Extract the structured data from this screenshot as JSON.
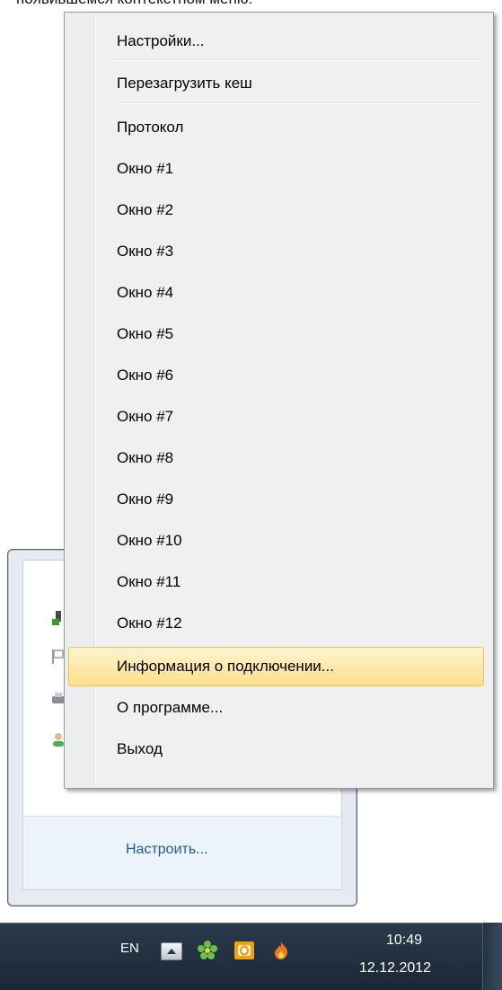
{
  "caption": "появившемся контекстном меню:",
  "menu": {
    "items": [
      {
        "label": "Настройки..."
      },
      {
        "label": "Перезагрузить кеш"
      },
      {
        "label": "Протокол"
      },
      {
        "label": "Окно #1"
      },
      {
        "label": "Окно #2"
      },
      {
        "label": "Окно #3"
      },
      {
        "label": "Окно #4"
      },
      {
        "label": "Окно #5"
      },
      {
        "label": "Окно #6"
      },
      {
        "label": "Окно #7"
      },
      {
        "label": "Окно #8"
      },
      {
        "label": "Окно #9"
      },
      {
        "label": "Окно #10"
      },
      {
        "label": "Окно #11"
      },
      {
        "label": "Окно #12"
      },
      {
        "label": "Информация о подключении..."
      },
      {
        "label": "О программе..."
      },
      {
        "label": "Выход"
      }
    ],
    "highlighted_item": "Информация о подключении..."
  },
  "tray_flyout": {
    "customize_link": "Настроить...",
    "icons": [
      "network-icon",
      "flag-icon",
      "printer-icon",
      "user-icon"
    ]
  },
  "taskbar": {
    "language": "EN",
    "time": "10:49",
    "date": "12.12.2012",
    "tray_icons": [
      "show-hidden-icons-button",
      "icq-flower-icon",
      "outlook-icon",
      "flame-app-icon"
    ]
  }
}
